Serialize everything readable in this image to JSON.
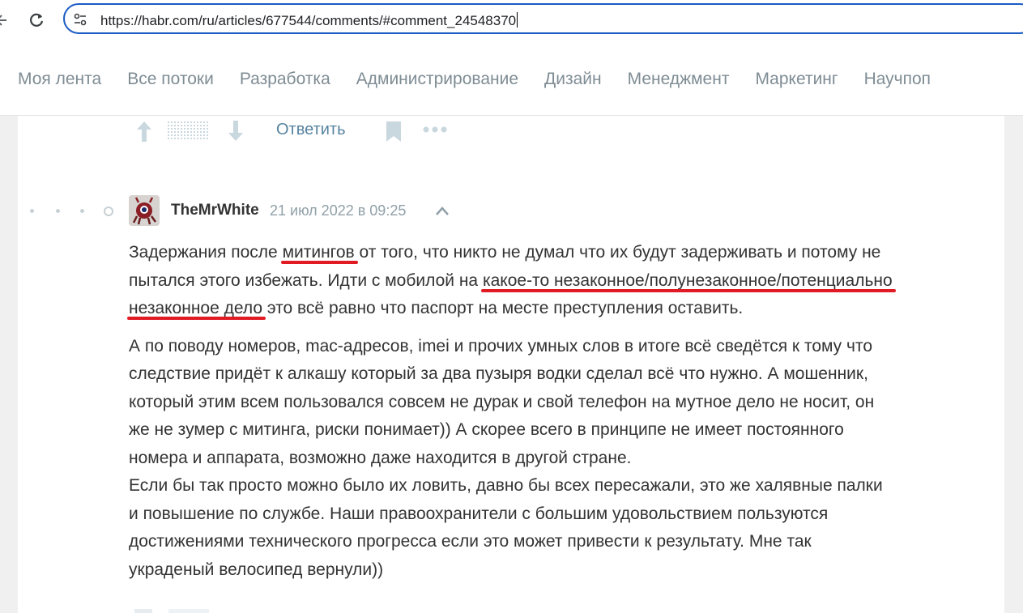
{
  "browser": {
    "url": "https://habr.com/ru/articles/677544/comments/#comment_24548370",
    "icons": {
      "back": "arrow-left-icon",
      "reload": "reload-icon",
      "site_info": "tune-icon"
    }
  },
  "nav": {
    "items": [
      {
        "label": "Моя лента"
      },
      {
        "label": "Все потоки"
      },
      {
        "label": "Разработка"
      },
      {
        "label": "Администрирование"
      },
      {
        "label": "Дизайн"
      },
      {
        "label": "Менеджмент"
      },
      {
        "label": "Маркетинг"
      },
      {
        "label": "Научпоп"
      }
    ]
  },
  "previous_comment_actions": {
    "reply_label": "Ответить",
    "icons": {
      "upvote": "arrow-up-icon",
      "score": "hidden-score-icon",
      "downvote": "arrow-down-icon",
      "bookmark": "bookmark-icon",
      "more": "more-dots-icon"
    }
  },
  "comment": {
    "author": "TheMrWhite",
    "date": "21 июл 2022 в 09:25",
    "paragraph1": {
      "l1_a": "Задержания после ",
      "l1_hl": "митингов",
      "l1_b": " от того, что никто не думал что их будут задерживать и потому не",
      "l2_a": "пытался этого избежать. Идти с мобилой на ",
      "l2_hl": "какое-то незаконное/полунезаконное/потенциально",
      "l3_hl": "незаконное дело",
      "l3_b": " это всё равно что паспорт на месте преступления оставить."
    },
    "paragraph2": {
      "lines": [
        "А по поводу номеров, mac-адресов, imei и прочих умных слов в итоге всё сведётся к тому что",
        "следствие придёт к алкашу который за два пузыря водки сделал всё что нужно. А мошенник,",
        "который этим всем пользовался совсем не дурак и свой телефон на мутное дело не носит, он",
        "же не зумер с митинга, риски понимает)) А скорее всего в принципе не имеет постоянного",
        "номера и аппарата, возможно даже находится в другой стране.",
        "Если бы так просто можно было их ловить, давно бы всех пересажали, это же халявные палки",
        "и повышение по службе. Наши правоохранители с большим удовольствием пользуются",
        "достижениями технического прогресса если это может привести к результату. Мне так",
        "украденый велосипед вернули))"
      ]
    }
  },
  "colors": {
    "annotation_underline": "#e01b24",
    "url_focus_border": "#1a5bc4",
    "link": "#56839f",
    "nav_text": "#7e8c94"
  }
}
